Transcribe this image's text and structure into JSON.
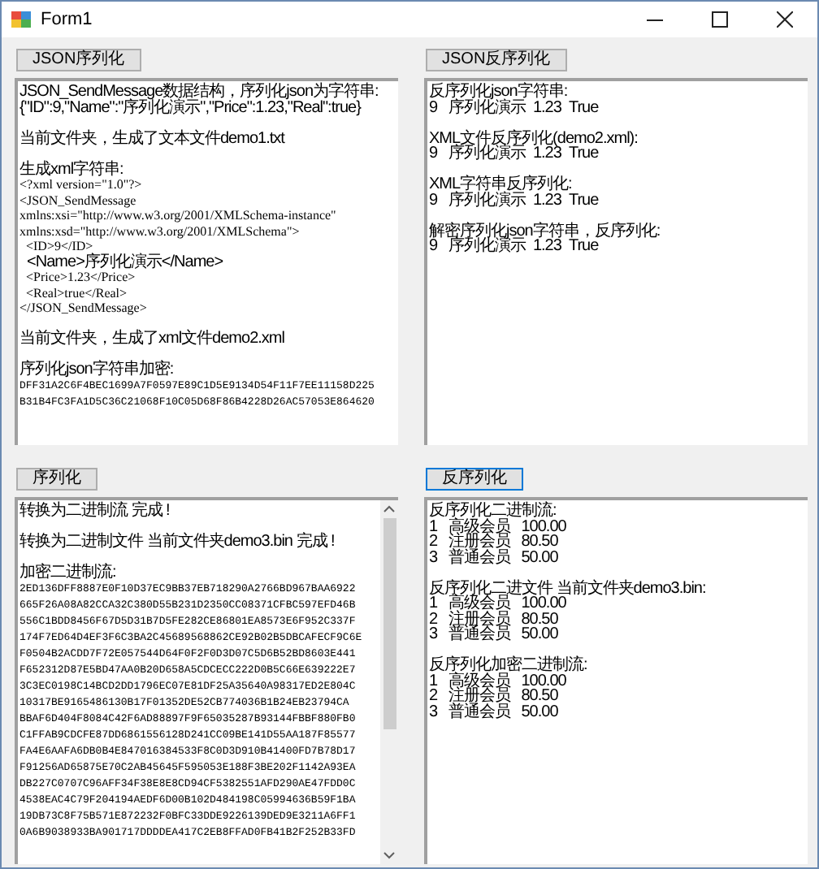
{
  "window": {
    "title": "Form1"
  },
  "panels": [
    {
      "button": {
        "label": "JSON序列化",
        "focused": false
      },
      "scrollbar": false,
      "paragraphs": [
        {
          "lines": [
            {
              "text": "JSON_SendMessage数据结构，序列化json为字符串:",
              "kind": "cjk"
            },
            {
              "text": "{\"ID\":9,\"Name\":\"序列化演示\",\"Price\":1.23,\"Real\":true}",
              "kind": "cjk"
            }
          ]
        },
        {
          "lines": [
            {
              "text": "当前文件夹，生成了文本文件demo1.txt",
              "kind": "cjk"
            }
          ]
        },
        {
          "lines": [
            {
              "text": "生成xml字符串:",
              "kind": "cjk"
            },
            {
              "text": "<?xml version=\"1.0\"?>",
              "kind": "ascii"
            },
            {
              "text": "<JSON_SendMessage",
              "kind": "ascii"
            },
            {
              "text": "xmlns:xsi=\"http://www.w3.org/2001/XMLSchema-instance\"",
              "kind": "ascii"
            },
            {
              "text": "xmlns:xsd=\"http://www.w3.org/2001/XMLSchema\">",
              "kind": "ascii"
            },
            {
              "text": "  <ID>9</ID>",
              "kind": "ascii"
            },
            {
              "text": "  <Name>序列化演示</Name>",
              "kind": "cjk"
            },
            {
              "text": "  <Price>1.23</Price>",
              "kind": "ascii"
            },
            {
              "text": "  <Real>true</Real>",
              "kind": "ascii"
            },
            {
              "text": "</JSON_SendMessage>",
              "kind": "ascii"
            }
          ]
        },
        {
          "lines": [
            {
              "text": "当前文件夹，生成了xml文件demo2.xml",
              "kind": "cjk"
            }
          ]
        },
        {
          "lines": [
            {
              "text": "序列化json字符串加密:",
              "kind": "cjk"
            },
            {
              "text": "DFF31A2C6F4BEC1699A7F0597E89C1D5E9134D54F11F7EE11158D225",
              "kind": "hex"
            },
            {
              "text": "B31B4FC3FA1D5C36C21068F10C05D68F86B4228D26AC57053E864620",
              "kind": "hex"
            }
          ]
        }
      ]
    },
    {
      "button": {
        "label": "JSON反序列化",
        "focused": false
      },
      "scrollbar": false,
      "paragraphs": [
        {
          "lines": [
            {
              "text": "反序列化json字符串:",
              "kind": "cjk"
            },
            {
              "text": "9   序列化演示  1.23  True",
              "kind": "cjk"
            }
          ]
        },
        {
          "lines": [
            {
              "text": "XML文件反序列化(demo2.xml):",
              "kind": "cjk"
            },
            {
              "text": "9   序列化演示  1.23  True",
              "kind": "cjk"
            }
          ]
        },
        {
          "lines": [
            {
              "text": "XML字符串反序列化:",
              "kind": "cjk"
            },
            {
              "text": "9   序列化演示  1.23  True",
              "kind": "cjk"
            }
          ]
        },
        {
          "lines": [
            {
              "text": "解密序列化json字符串，反序列化:",
              "kind": "cjk"
            },
            {
              "text": "9   序列化演示  1.23  True",
              "kind": "cjk"
            }
          ]
        }
      ]
    },
    {
      "button": {
        "label": "序列化",
        "focused": false
      },
      "scrollbar": true,
      "paragraphs": [
        {
          "lines": [
            {
              "text": "转换为二进制流 完成 !",
              "kind": "cjk"
            }
          ]
        },
        {
          "lines": [
            {
              "text": "转换为二进制文件 当前文件夹demo3.bin 完成 !",
              "kind": "cjk"
            }
          ]
        },
        {
          "lines": [
            {
              "text": "加密二进制流:",
              "kind": "cjk"
            },
            {
              "text": "2ED136DFF8887E0F10D37EC9BB37EB718290A2766BD967BAA6922",
              "kind": "hex"
            },
            {
              "text": "665F26A08A82CCA32C380D55B231D2350CC08371CFBC597EFD46B",
              "kind": "hex"
            },
            {
              "text": "556C1BDD8456F67D5D31B7D5FE282CE86801EA8573E6F952C337F",
              "kind": "hex"
            },
            {
              "text": "174F7ED64D4EF3F6C3BA2C45689568862CE92B02B5DBCAFECF9C6E",
              "kind": "hex"
            },
            {
              "text": "F0504B2ACDD7F72E057544D64F0F2F0D3D07C5D6B52BD8603E441",
              "kind": "hex"
            },
            {
              "text": "F652312D87E5BD47AA0B20D658A5CDCECC222D0B5C66E639222E7",
              "kind": "hex"
            },
            {
              "text": "3C3EC0198C14BCD2DD1796EC07E81DF25A35640A98317ED2E804C",
              "kind": "hex"
            },
            {
              "text": "10317BE9165486130B17F01352DE52CB774036B1B24EB23794CA",
              "kind": "hex"
            },
            {
              "text": "BBAF6D404F8084C42F6AD88897F9F65035287B93144FBBF880FB0",
              "kind": "hex"
            },
            {
              "text": "C1FFAB9CDCFE87DD6861556128D241CC09BE141D55AA187F85577",
              "kind": "hex"
            },
            {
              "text": "FA4E6AAFA6DB0B4E847016384533F8C0D3D910B41400FD7B78D17",
              "kind": "hex"
            },
            {
              "text": "F91256AD65875E70C2AB45645F595053E188F3BE202F1142A93EA",
              "kind": "hex"
            },
            {
              "text": "DB227C0707C96AFF34F38E8E8CD94CF5382551AFD290AE47FDD0C",
              "kind": "hex"
            },
            {
              "text": "4538EAC4C79F204194AEDF6D00B102D484198C05994636B59F1BA",
              "kind": "hex"
            },
            {
              "text": "19DB73C8F75B571E872232F0BFC33DDE9226139DED9E3211A6FF1",
              "kind": "hex"
            },
            {
              "text": "0A6B9038933BA901717DDDDEA417C2EB8FFAD0FB41B2F252B33FD",
              "kind": "hex"
            }
          ]
        }
      ]
    },
    {
      "button": {
        "label": "反序列化",
        "focused": true
      },
      "scrollbar": false,
      "paragraphs": [
        {
          "lines": [
            {
              "text": "反序列化二进制流:",
              "kind": "cjk"
            },
            {
              "text": "1   高级会员   100.00",
              "kind": "cjk"
            },
            {
              "text": "2   注册会员   80.50",
              "kind": "cjk"
            },
            {
              "text": "3   普通会员   50.00",
              "kind": "cjk"
            }
          ]
        },
        {
          "lines": [
            {
              "text": "反序列化二进文件 当前文件夹demo3.bin:",
              "kind": "cjk"
            },
            {
              "text": "1   高级会员   100.00",
              "kind": "cjk"
            },
            {
              "text": "2   注册会员   80.50",
              "kind": "cjk"
            },
            {
              "text": "3   普通会员   50.00",
              "kind": "cjk"
            }
          ]
        },
        {
          "lines": [
            {
              "text": "反序列化加密二进制流:",
              "kind": "cjk"
            },
            {
              "text": "1   高级会员   100.00",
              "kind": "cjk"
            },
            {
              "text": "2   注册会员   80.50",
              "kind": "cjk"
            },
            {
              "text": "3   普通会员   50.00",
              "kind": "cjk"
            }
          ]
        }
      ]
    }
  ]
}
